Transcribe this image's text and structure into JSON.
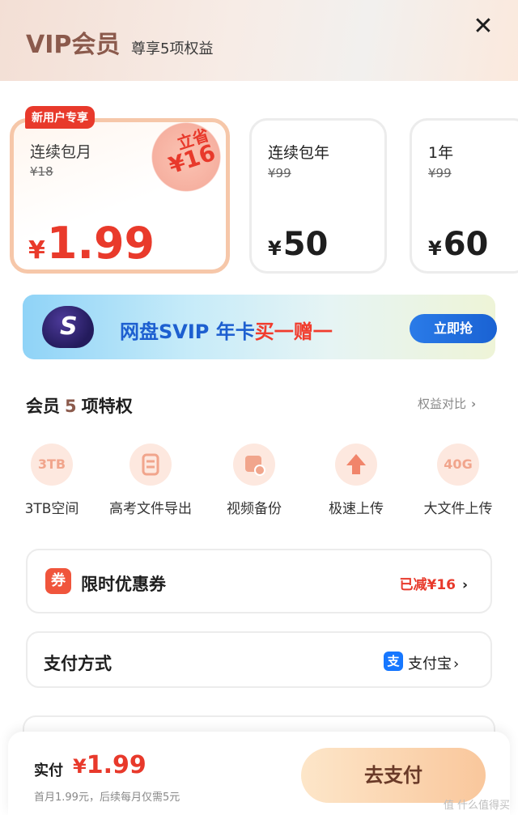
{
  "header": {
    "title": "VIP会员",
    "subtitle": "尊享5项权益"
  },
  "plans": [
    {
      "name": "连续包月",
      "original": "¥18",
      "currency": "¥",
      "price": "1.99",
      "badge": "新用户专享",
      "stamp_top": "立省",
      "stamp_bottom": "¥16"
    },
    {
      "name": "连续包年",
      "original": "¥99",
      "currency": "¥",
      "price": "50"
    },
    {
      "name": "1年",
      "original": "¥99",
      "currency": "¥",
      "price": "60"
    }
  ],
  "banner": {
    "logo_letter": "S",
    "text_a": "网盘SVIP 年卡",
    "text_b": "买一赠一",
    "button": "立即抢"
  },
  "privileges": {
    "title_a": "会员",
    "count": "5",
    "title_b": "项特权",
    "compare": "权益对比",
    "items": [
      {
        "icon": "3TB",
        "label": "3TB空间"
      },
      {
        "icon": "",
        "label": "高考文件导出"
      },
      {
        "icon": "",
        "label": "视频备份"
      },
      {
        "icon": "",
        "label": "极速上传"
      },
      {
        "icon": "40G",
        "label": "大文件上传"
      }
    ]
  },
  "coupon": {
    "icon": "券",
    "label": "限时优惠券",
    "value": "已减¥16"
  },
  "payment": {
    "label": "支付方式",
    "icon": "支",
    "method": "支付宝"
  },
  "checkout": {
    "label": "实付",
    "currency": "¥",
    "price": "1.99",
    "note": "首月1.99元，后续每月仅需5元",
    "button": "去支付"
  },
  "watermark": "值 什么值得买",
  "colors": {
    "accent": "#e8392b",
    "brand": "#8b5a4c",
    "link": "#1d5fd0"
  }
}
